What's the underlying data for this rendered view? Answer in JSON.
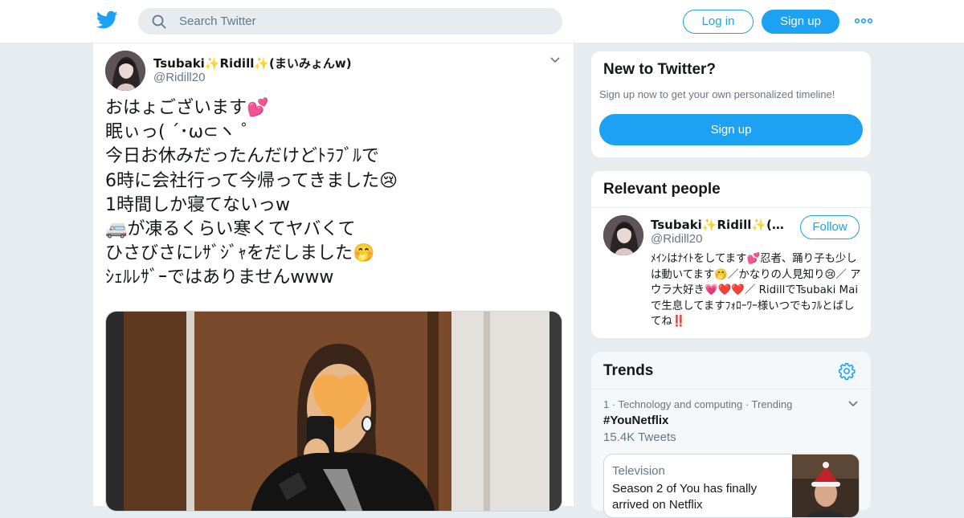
{
  "header": {
    "search_placeholder": "Search Twitter",
    "login_label": "Log in",
    "signup_label": "Sign up",
    "brand_color": "#1da1f2"
  },
  "tweet": {
    "author_name": "Tsubaki✨Ridill✨(まいみょんw)",
    "author_handle": "@Ridill20",
    "lines": [
      "おはょございます💕",
      "眠ぃっ( ´･ω⊂ヽ ゜",
      "今日お休みだったんだけどﾄﾗﾌﾞﾙで",
      "6時に会社行って今帰ってきました😢",
      "1時間しか寝てないっw",
      "🚐が凍るくらい寒くてヤバくて",
      "ひさびさにﾚｻﾞｼﾞｬをだしました🤭",
      "ｼｪﾙﾚｻﾞｰではありませんwww"
    ]
  },
  "new_to_twitter": {
    "title": "New to Twitter?",
    "subtitle": "Sign up now to get your own personalized timeline!",
    "button": "Sign up"
  },
  "relevant_people": {
    "title": "Relevant people",
    "name": "Tsubaki✨Ridill✨(まいみょんw)",
    "handle": "@Ridill20",
    "follow_label": "Follow",
    "bio": "ﾒｲﾝはﾅｲﾄをしてます💕忍者、踊り子も少しは動いてます🤭／かなりの人見知り😢／ アウラ大好き💗❤️❤️／ RidillでTsubaki Maiで生息してますﾌｫﾛｰﾜｰ様いつでもﾌﾙとばしてね‼️"
  },
  "trends": {
    "title": "Trends",
    "items": [
      {
        "meta": "1 · Technology and computing · Trending",
        "name": "#YouNetflix",
        "count": "15.4K Tweets",
        "moment_category": "Television",
        "moment_headline": "Season 2 of You has finally arrived on Netflix"
      }
    ]
  }
}
